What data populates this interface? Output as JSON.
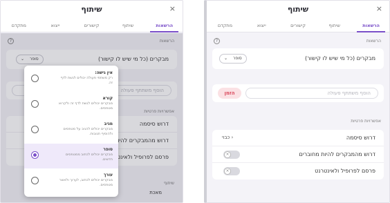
{
  "accent": "#7a4fc9",
  "danger": "#d9465a",
  "dialog": {
    "title": "שיתוף",
    "close": "×"
  },
  "tabs": [
    "הרשאות",
    "שיתוף",
    "קישורים",
    "ייצוא",
    "מתקדם"
  ],
  "permissions": {
    "section_label": "הרשאות",
    "mode_label": "מבקרים (כל מי שיש לו קישור)",
    "mode_value": "סופר"
  },
  "share_input": {
    "placeholder": "הוסף משתתף פעולה",
    "button": "הזמן"
  },
  "options": {
    "section_label": "אפשרויות פרטיות",
    "password": {
      "label": "דרוש סיסמה",
      "value": "כבוי"
    },
    "require_login": {
      "label": "דרוש מהמבקרים להיות מחוברים"
    },
    "publish": {
      "label": "פרסם לפרופיל ולאינטרנט"
    }
  },
  "left_panel": {
    "section_label": "שיתוף",
    "bottom_hint": "מאכת"
  },
  "popup": {
    "items": [
      {
        "title": "אין גישה:",
        "desc": "רק משתפי פעולה יכולים לגשת לדף זה.",
        "selected": false
      },
      {
        "title": "קורא",
        "desc": "מבקרים יכולים לגשת לדף זה ולקרוא מטפסים.",
        "selected": false
      },
      {
        "title": "מגיב",
        "desc": "מבקרים יכולים להגיב על מטפסים ולהוסיף תגובות.",
        "selected": false
      },
      {
        "title": "סופר",
        "desc": "מבקרים יכולים לכתוב ממטפסים חדשים.",
        "selected": true
      },
      {
        "title": "עורך",
        "desc": "מבקרים יכולים לכתוב, לערוך ולאשר מטפסים.",
        "selected": false
      }
    ]
  }
}
